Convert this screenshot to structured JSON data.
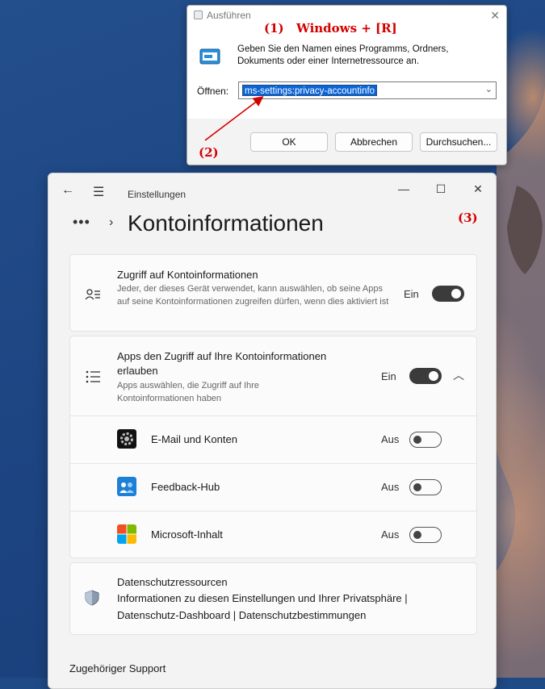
{
  "run_dialog": {
    "title": "Ausführen",
    "close_glyph": "✕",
    "description": "Geben Sie den Namen eines Programms, Ordners, Dokuments oder einer Internetressource an.",
    "open_label": "Öffnen:",
    "input_value": "ms-settings:privacy-accountinfo",
    "buttons": {
      "ok": "OK",
      "cancel": "Abbrechen",
      "browse": "Durchsuchen..."
    }
  },
  "annotations": {
    "step1_num": "(1)",
    "step1_text": "Windows + [R]",
    "step2": "(2)",
    "step3": "(3)"
  },
  "settings": {
    "app_title": "Einstellungen",
    "page_title": "Kontoinformationen",
    "access_card": {
      "title": "Zugriff auf Kontoinformationen",
      "description": "Jeder, der dieses Gerät verwendet, kann auswählen, ob seine Apps auf seine Kontoinformationen zugreifen dürfen, wenn dies aktiviert ist",
      "state": "Ein",
      "on": true
    },
    "apps_card": {
      "title": "Apps den Zugriff auf Ihre Kontoinformationen erlauben",
      "description": "Apps auswählen, die Zugriff auf Ihre Kontoinformationen haben",
      "state": "Ein",
      "on": true,
      "apps": [
        {
          "name": "E-Mail und Konten",
          "state": "Aus",
          "icon": "mail-accounts-icon"
        },
        {
          "name": "Feedback-Hub",
          "state": "Aus",
          "icon": "feedback-hub-icon"
        },
        {
          "name": "Microsoft-Inhalt",
          "state": "Aus",
          "icon": "microsoft-logo-icon"
        }
      ]
    },
    "privacy_card": {
      "title": "Datenschutzressourcen",
      "links_line1": "Informationen zu diesen Einstellungen und Ihrer Privatsphäre |",
      "links_line2": "Datenschutz-Dashboard | Datenschutzbestimmungen"
    },
    "support_heading": "Zugehöriger Support"
  },
  "colors": {
    "annotation": "#d40000",
    "selection": "#0a64d6",
    "toggle_on": "#3b3b3b"
  }
}
